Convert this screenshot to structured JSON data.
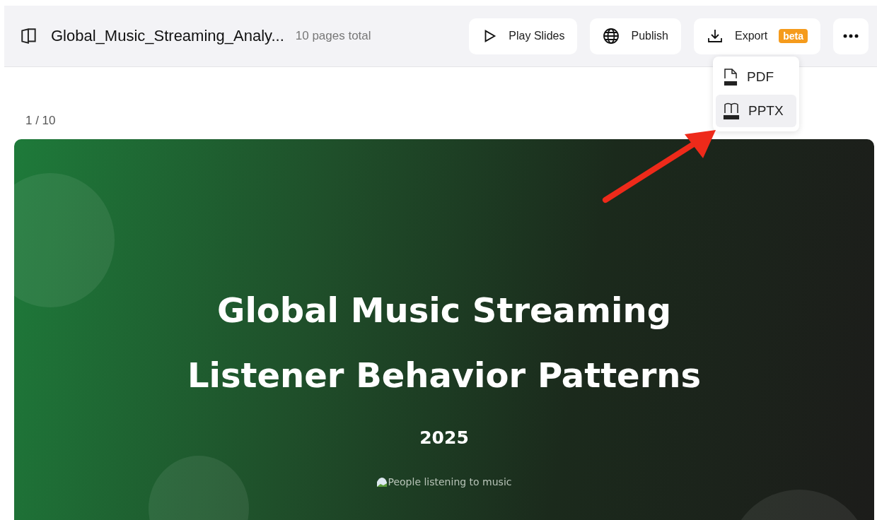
{
  "header": {
    "title": "Global_Music_Streaming_Analy...",
    "page_count": "10 pages total",
    "buttons": [
      {
        "kind": "play",
        "label": "Play Slides"
      },
      {
        "kind": "publish",
        "label": "Publish"
      },
      {
        "kind": "export",
        "label": "Export",
        "badge": "beta"
      },
      {
        "kind": "more"
      }
    ]
  },
  "export_menu": {
    "items": [
      {
        "kind": "pdf",
        "label": "PDF",
        "selected": false
      },
      {
        "kind": "pptx",
        "label": "PPTX",
        "selected": true
      }
    ]
  },
  "page_indicator": "1 / 10",
  "slide": {
    "title_lines": [
      "Global Music Streaming",
      "Listener Behavior Patterns"
    ],
    "year": "2025",
    "image_alt": "People listening to music"
  }
}
